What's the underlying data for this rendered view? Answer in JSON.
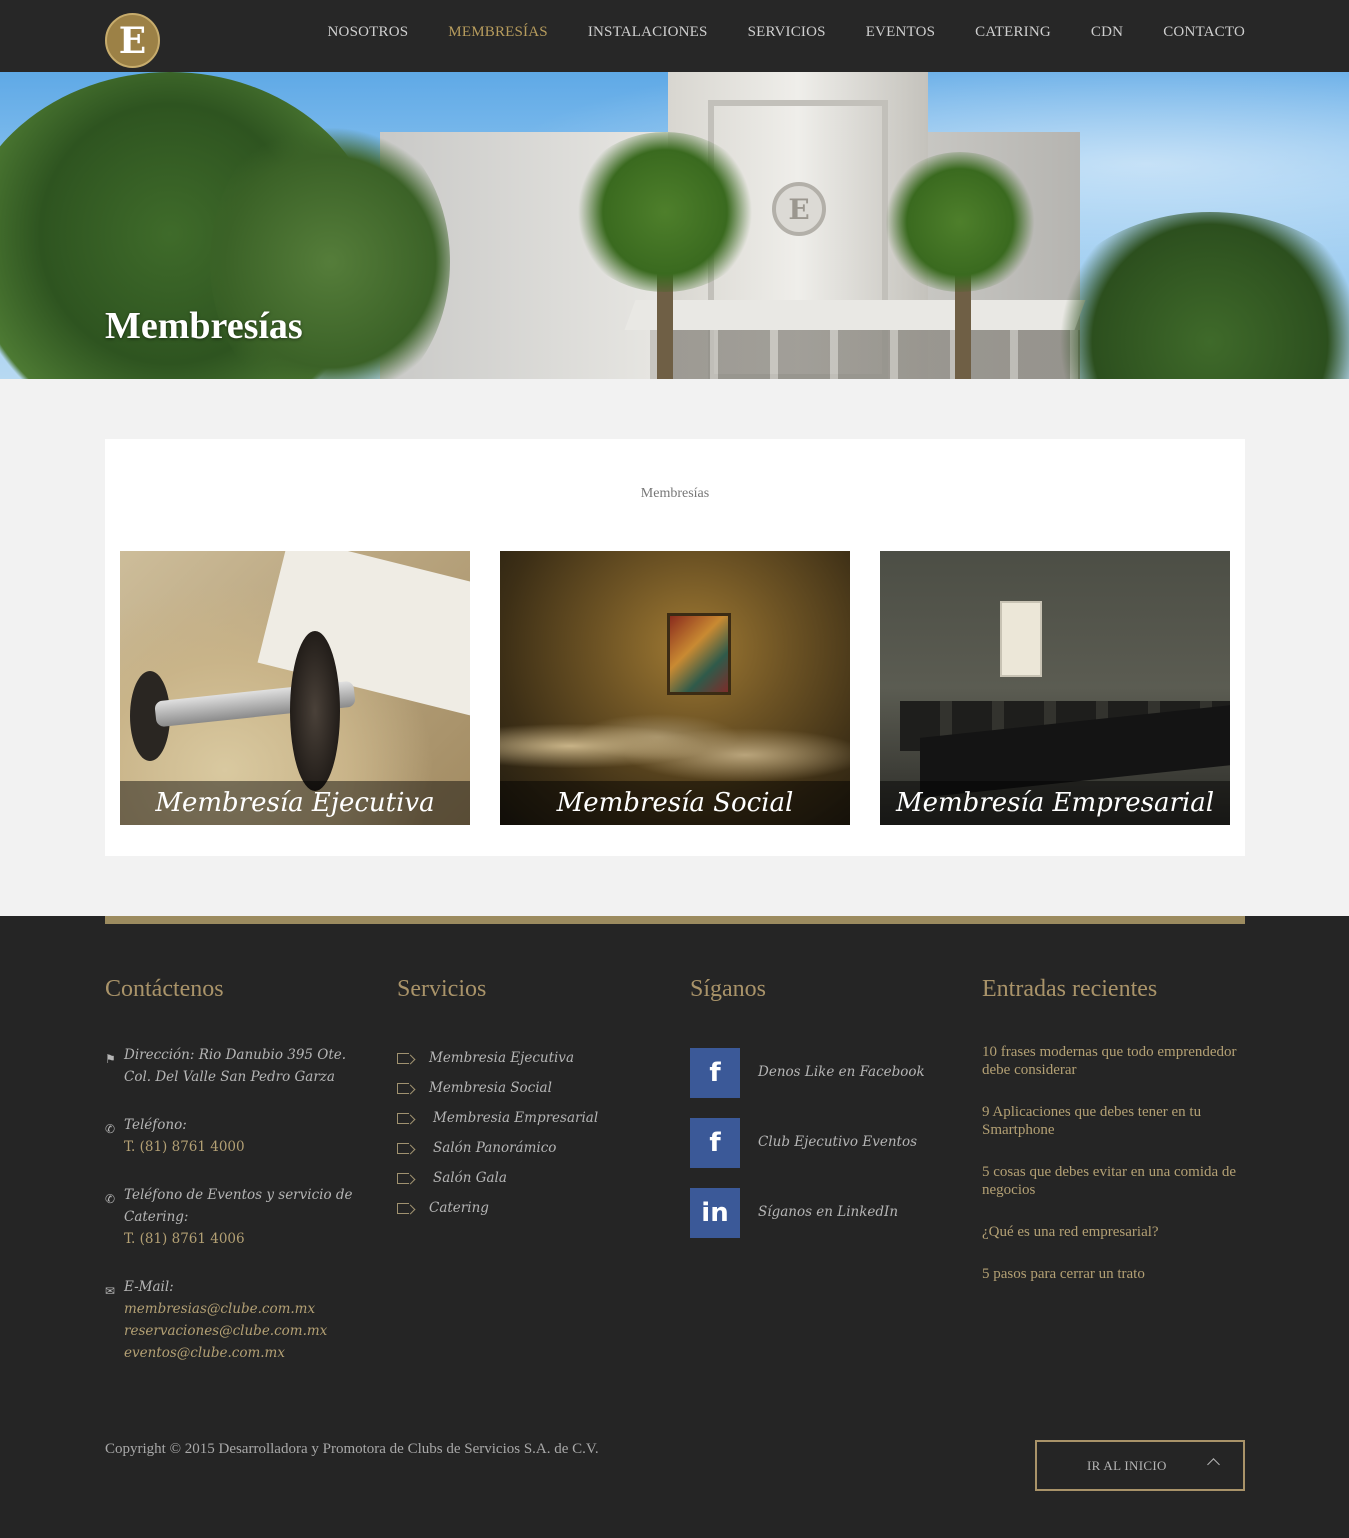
{
  "header": {
    "logo_letter": "E",
    "nav": [
      {
        "label": "NOSOTROS",
        "active": false
      },
      {
        "label": "MEMBRESÍAS",
        "active": true
      },
      {
        "label": "INSTALACIONES",
        "active": false
      },
      {
        "label": "SERVICIOS",
        "active": false
      },
      {
        "label": "EVENTOS",
        "active": false
      },
      {
        "label": "CATERING",
        "active": false
      },
      {
        "label": "CDN",
        "active": false
      },
      {
        "label": "CONTACTO",
        "active": false
      }
    ]
  },
  "hero": {
    "title": "Membresías",
    "emblem_letter": "E"
  },
  "content": {
    "section_title": "Membresías",
    "tiles": [
      {
        "caption": "Membresía Ejecutiva"
      },
      {
        "caption": "Membresía Social"
      },
      {
        "caption": "Membresía Empresarial"
      }
    ]
  },
  "footer": {
    "contact": {
      "title": "Contáctenos",
      "address_label": "Dirección:",
      "address": "Rio Danubio 395 Ote. Col. Del Valle San Pedro Garza",
      "phone_label": "Teléfono:",
      "phone": "T. (81) 8761 4000",
      "events_phone_label": "Teléfono de Eventos y servicio de Catering:",
      "events_phone": "T. (81) 8761 4006",
      "email_label": "E-Mail:",
      "emails": [
        "membresias@clube.com.mx",
        "reservaciones@clube.com.mx",
        "eventos@clube.com.mx"
      ]
    },
    "services": {
      "title": "Servicios",
      "items": [
        "Membresia Ejecutiva",
        "Membresia Social",
        "Membresia Empresarial",
        "Salón Panorámico",
        "Salón Gala",
        "Catering"
      ]
    },
    "follow": {
      "title": "Síganos",
      "items": [
        {
          "icon": "facebook-icon",
          "glyph": "f",
          "label": "Denos Like en Facebook"
        },
        {
          "icon": "facebook-icon",
          "glyph": "f",
          "label": "Club Ejecutivo Eventos"
        },
        {
          "icon": "linkedin-icon",
          "glyph": "in",
          "label": "Síganos en LinkedIn"
        }
      ]
    },
    "recent": {
      "title": "Entradas recientes",
      "posts": [
        "10 frases modernas que todo emprendedor debe considerar",
        "9 Aplicaciones que debes tener en tu Smartphone",
        "5 cosas que debes evitar en una comida de negocios",
        "¿Qué es una red empresarial?",
        "5 pasos para cerrar un trato"
      ]
    },
    "copyright": "Copyright © 2015 Desarrolladora y Promotora de Clubs de Servicios S.A. de C.V.",
    "back_to_top": "IR AL INICIO"
  },
  "colors": {
    "header_bg": "#272727",
    "accent_gold": "#b79c5d",
    "footer_bg": "#252525",
    "facebook_blue": "#3b5998"
  }
}
